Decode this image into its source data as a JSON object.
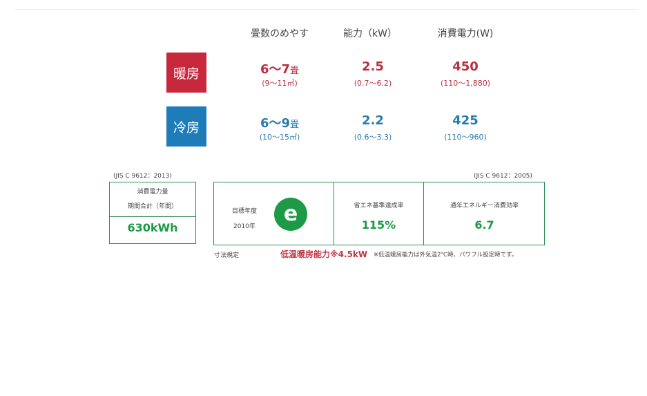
{
  "header": {
    "tatami": "畳数のめやす",
    "power": "能力（kW）",
    "consumption": "消費電力(W)"
  },
  "heating": {
    "label": "暖房",
    "tatami_value": "6～7",
    "tatami_unit": "畳",
    "tatami_sub": "(9～11㎡)",
    "power_value": "2.5",
    "power_sub": "(0.7～6.2)",
    "cons_value": "450",
    "cons_sub": "(110～1,880)"
  },
  "cooling": {
    "label": "冷房",
    "tatami_value": "6～9",
    "tatami_unit": "畳",
    "tatami_sub": "(10～15㎡)",
    "power_value": "2.2",
    "power_sub": "(0.6～3.3)",
    "cons_value": "425",
    "cons_sub": "(110～960)"
  },
  "jis": {
    "left": "(JIS C 9612：2013)",
    "right": "(JIS C 9612：2005)"
  },
  "annual": {
    "label1": "消費電力量",
    "label2": "期間合計（年間）",
    "value": "630kWh"
  },
  "energy": {
    "target_label": "目標年度",
    "target_year": "2010年",
    "achievement_title": "省エネ基準達成率",
    "achievement_value": "115%",
    "apf_title": "通年エネルギー消費効率",
    "apf_value": "6.7",
    "e_mark_letter": "e"
  },
  "notes": {
    "dimension": "寸法規定",
    "low_temp": "低温暖房能力※4.5kW",
    "low_temp_note": "※低温暖房能力は外気温2℃時、パワフル設定時です。"
  },
  "colors": {
    "heat": "#c8283b",
    "cool": "#1e7db8",
    "green": "#1c9a46"
  }
}
